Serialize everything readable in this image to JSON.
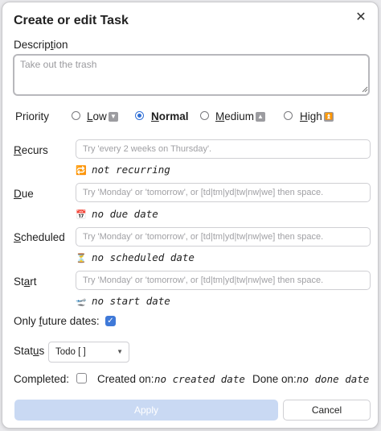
{
  "dialog": {
    "title": "Create or edit Task",
    "close_glyph": "✕"
  },
  "description": {
    "label_pre": "Descrip",
    "label_u": "t",
    "label_post": "ion",
    "placeholder": "Take out the trash",
    "value": ""
  },
  "priority": {
    "label": "Priority",
    "selected": "Normal",
    "options": [
      {
        "pre": "",
        "u": "L",
        "post": "ow",
        "icon": "chevron-down-icon",
        "glyph": "▼"
      },
      {
        "pre": "",
        "u": "N",
        "post": "ormal",
        "icon": "",
        "glyph": ""
      },
      {
        "pre": "",
        "u": "M",
        "post": "edium",
        "icon": "chevron-up-icon",
        "glyph": "▲"
      },
      {
        "pre": "",
        "u": "H",
        "post": "igh",
        "icon": "double-chevron-up-icon",
        "glyph": "⏫"
      }
    ]
  },
  "recurs": {
    "label_u": "R",
    "label_post": "ecurs",
    "placeholder": "Try 'every 2 weeks on Thursday'.",
    "hint": "not recurring",
    "hint_icon": "repeat-icon",
    "hint_glyph": "🔁"
  },
  "due": {
    "label_u": "D",
    "label_post": "ue",
    "placeholder": "Try 'Monday' or 'tomorrow', or [td|tm|yd|tw|nw|we] then space.",
    "hint": "no due date",
    "hint_icon": "calendar-icon",
    "hint_glyph": "📅"
  },
  "scheduled": {
    "label_u": "S",
    "label_post": "cheduled",
    "placeholder": "Try 'Monday' or 'tomorrow', or [td|tm|yd|tw|nw|we] then space.",
    "hint": "no scheduled date",
    "hint_icon": "hourglass-icon",
    "hint_glyph": "⏳"
  },
  "start": {
    "label_pre": "St",
    "label_u": "a",
    "label_post": "rt",
    "placeholder": "Try 'Monday' or 'tomorrow', or [td|tm|yd|tw|nw|we] then space.",
    "hint": "no start date",
    "hint_icon": "airplane-departure-icon",
    "hint_glyph": "🛫"
  },
  "only_future": {
    "label_pre": "Only ",
    "label_u": "f",
    "label_post": "uture dates:",
    "checked": true
  },
  "status": {
    "label_pre": "Stat",
    "label_u": "u",
    "label_post": "s",
    "value": "Todo [ ]"
  },
  "footer_info": {
    "completed_label": "Completed:",
    "completed_checked": false,
    "created_label": "Created on:",
    "created_value": "no created date",
    "done_label": "Done on:",
    "done_value": "no done date"
  },
  "buttons": {
    "apply": "Apply",
    "cancel": "Cancel"
  },
  "colors": {
    "accent": "#3f79d8",
    "apply_disabled": "#c9d9f3"
  }
}
